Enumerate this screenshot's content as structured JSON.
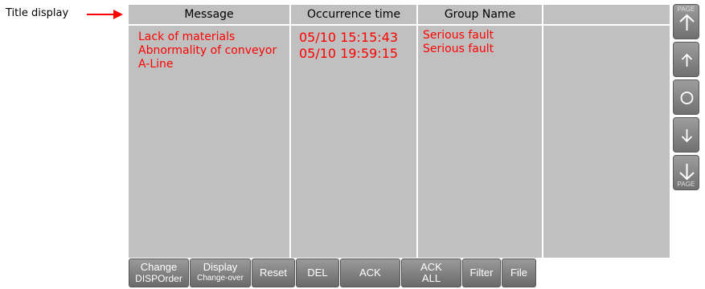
{
  "annotation": {
    "label": "Title display"
  },
  "columns": [
    {
      "header": "Message"
    },
    {
      "header": "Occurrence time"
    },
    {
      "header": "Group Name"
    },
    {
      "header": ""
    }
  ],
  "rows": [
    {
      "message": "Lack of materials",
      "time": "05/10 15:15:43",
      "group": "Serious fault"
    },
    {
      "message": "Abnormality of conveyor",
      "time": "05/10 19:59:15",
      "group": "Serious fault"
    },
    {
      "message": "A-Line",
      "time": "",
      "group": ""
    }
  ],
  "side_buttons": {
    "page_up_label": "PAGE",
    "page_down_label": "PAGE",
    "icons": [
      "page-up-icon",
      "arrow-up-icon",
      "circle-icon",
      "arrow-down-icon",
      "page-down-icon"
    ]
  },
  "toolbar": {
    "change_line1": "Change",
    "change_line2": "DISPOrder",
    "display_line1": "Display",
    "display_line2": "Change-over",
    "reset": "Reset",
    "del": "DEL",
    "ack": "ACK",
    "ack_all_line1": "ACK",
    "ack_all_line2": "ALL",
    "filter": "Filter",
    "file": "File"
  },
  "colors": {
    "alarm_text": "#ff0000",
    "table_bg": "#c0c0c0",
    "annotation_arrow": "#ff0000"
  }
}
